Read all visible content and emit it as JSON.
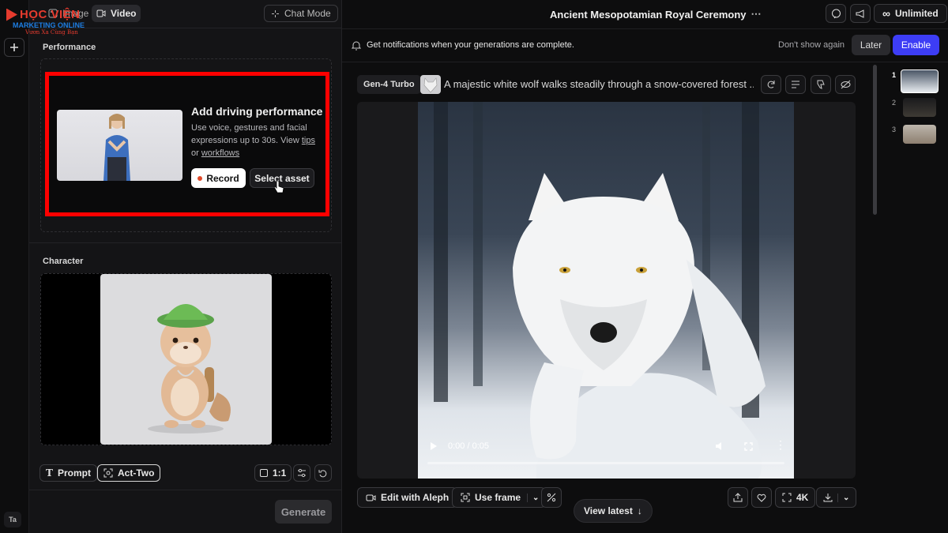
{
  "logo": {
    "line1": "HỌC VIỆN",
    "line2": "MARKETING ONLINE",
    "line3": "Vươn Xa Cùng Bạn"
  },
  "rail": {
    "avatar_initials": "Ta"
  },
  "left": {
    "tabs": [
      {
        "label": "Image",
        "icon": "image-icon"
      },
      {
        "label": "Video",
        "icon": "video-icon"
      }
    ],
    "chat_mode_label": "Chat Mode",
    "performance": {
      "title": "Performance",
      "heading": "Add driving performance",
      "desc": "Use voice, gestures and facial expressions up to 30s.",
      "view_prefix": "View",
      "tips_link": "tips",
      "or_text": "or",
      "workflows_link": "workflows",
      "record_label": "Record",
      "select_asset_label": "Select asset"
    },
    "character": {
      "title": "Character"
    },
    "toolbar": {
      "prompt_label": "Prompt",
      "act_two_label": "Act-Two",
      "ratio_label": "1:1"
    },
    "generate_label": "Generate"
  },
  "header": {
    "title": "Ancient Mesopotamian Royal Ceremony",
    "unlimited_label": "Unlimited"
  },
  "notification": {
    "text": "Get notifications when your generations are complete.",
    "dont_show_label": "Don't show again",
    "later_label": "Later",
    "enable_label": "Enable"
  },
  "generation": {
    "model_badge": "Gen-4 Turbo",
    "prompt": "A majestic white wolf walks steadily through a snow-covered forest ...",
    "time_label": "0:00 / 0:05",
    "progress": 0
  },
  "actions": {
    "edit_label": "Edit with Aleph",
    "use_frame_label": "Use frame",
    "view_latest_label": "View latest",
    "resolution_label": "4K"
  },
  "queue": [
    {
      "num": "1"
    },
    {
      "num": "2"
    },
    {
      "num": "3"
    }
  ],
  "colors": {
    "accent": "#3d3df5",
    "highlight": "#ff0000"
  }
}
